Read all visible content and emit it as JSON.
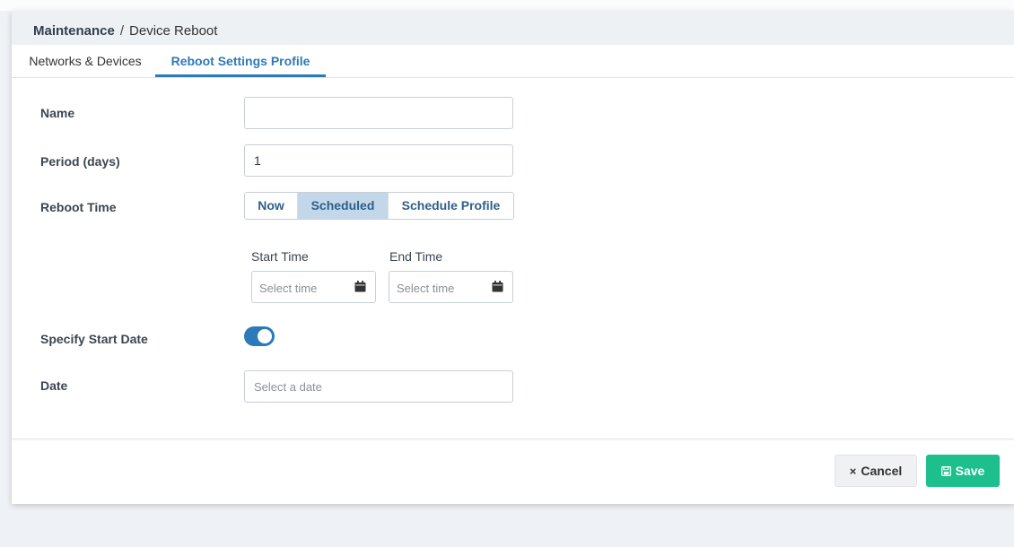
{
  "breadcrumb": {
    "main": "Maintenance",
    "separator": "/",
    "sub": "Device Reboot"
  },
  "tabs": [
    {
      "label": "Networks & Devices",
      "active": false
    },
    {
      "label": "Reboot Settings Profile",
      "active": true
    }
  ],
  "form": {
    "name": {
      "label": "Name",
      "value": ""
    },
    "period": {
      "label": "Period (days)",
      "value": "1"
    },
    "reboot_time": {
      "label": "Reboot Time",
      "options": [
        "Now",
        "Scheduled",
        "Schedule Profile"
      ],
      "selected": "Scheduled"
    },
    "start_time": {
      "label": "Start Time",
      "placeholder": "Select time",
      "icon": "calendar-icon"
    },
    "end_time": {
      "label": "End Time",
      "placeholder": "Select time",
      "icon": "calendar-icon"
    },
    "specify_start_date": {
      "label": "Specify Start Date",
      "enabled": true
    },
    "date": {
      "label": "Date",
      "placeholder": "Select a date"
    }
  },
  "actions": {
    "cancel": {
      "label": "Cancel",
      "icon": "close-icon"
    },
    "save": {
      "label": "Save",
      "icon": "save-icon"
    }
  },
  "colors": {
    "accent": "#2c7ab8",
    "save": "#1dbf8d",
    "selected_segment": "#c3d7ea"
  }
}
